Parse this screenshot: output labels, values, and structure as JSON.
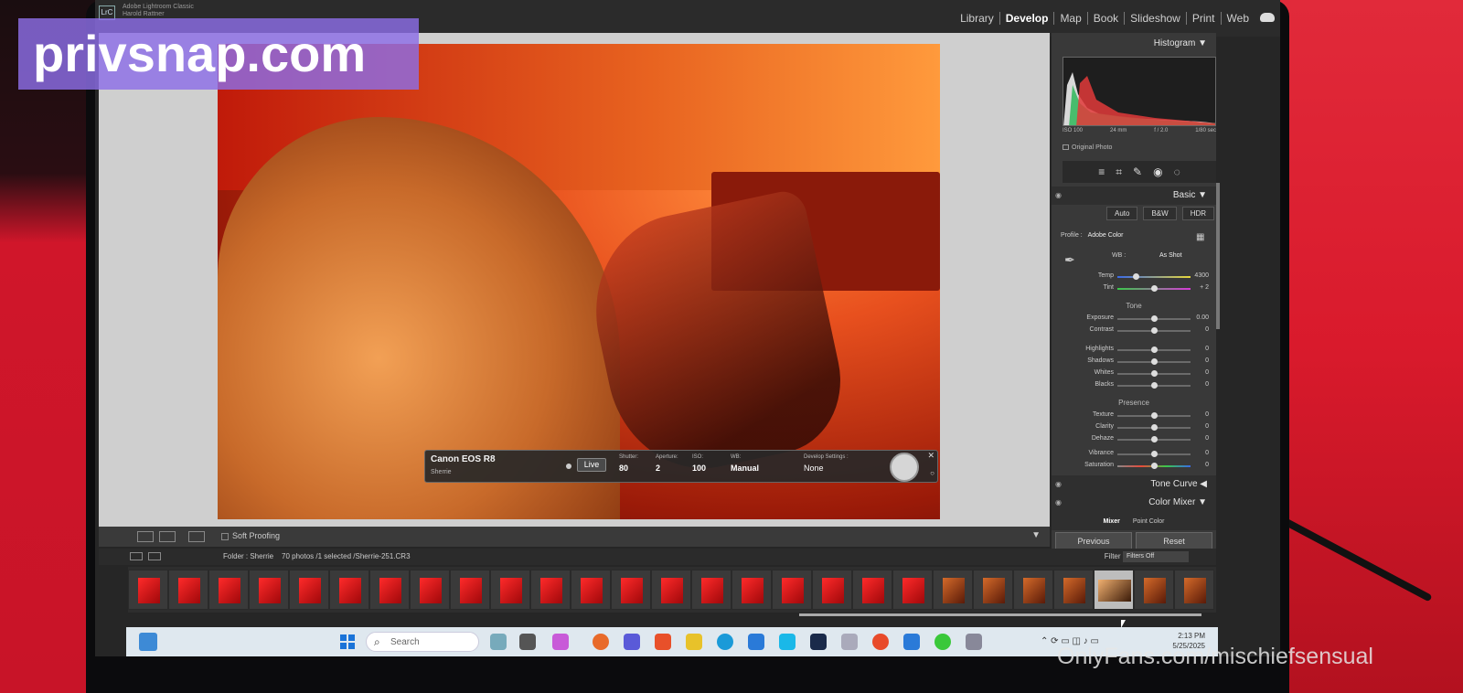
{
  "watermark": {
    "site": "privsnap.com",
    "credit": "OnlyFans.com/mischiefsensual"
  },
  "app": {
    "logo": "LrC",
    "name": "Adobe Lightroom Classic",
    "user": "Harold Rattner"
  },
  "modules": [
    "Library",
    "Develop",
    "Map",
    "Book",
    "Slideshow",
    "Print",
    "Web"
  ],
  "active_module": "Develop",
  "tether": {
    "camera": "Canon EOS R8",
    "session": "Sherrie",
    "live_label": "Live",
    "fields": [
      {
        "label": "Shutter:",
        "value": "80"
      },
      {
        "label": "Aperture:",
        "value": "2"
      },
      {
        "label": "ISO:",
        "value": "100"
      },
      {
        "label": "WB:",
        "value": "Manual"
      },
      {
        "label": "Develop Settings :",
        "value": "None"
      }
    ]
  },
  "toolbar": {
    "soft_proofing": "Soft Proofing"
  },
  "panel": {
    "histogram_title": "Histogram",
    "exif": [
      "ISO 100",
      "24 mm",
      "f / 2.0",
      "1/80 sec"
    ],
    "original_photo": "Original Photo",
    "tool_icons": [
      "sliders-icon",
      "crop-icon",
      "heal-icon",
      "redeye-icon",
      "mask-icon"
    ],
    "basic_title": "Basic",
    "treatment_buttons": [
      "Auto",
      "B&W",
      "HDR"
    ],
    "profile_label": "Profile :",
    "profile_value": "Adobe Color",
    "wb_label": "WB :",
    "wb_value": "As Shot",
    "temp": {
      "name": "Temp",
      "value": "4300",
      "pos": 0.25
    },
    "tint": {
      "name": "Tint",
      "value": "+ 2",
      "pos": 0.5
    },
    "tone_label": "Tone",
    "tone": [
      {
        "name": "Exposure",
        "value": "0.00",
        "pos": 0.5
      },
      {
        "name": "Contrast",
        "value": "0",
        "pos": 0.5
      }
    ],
    "tone2": [
      {
        "name": "Highlights",
        "value": "0",
        "pos": 0.5
      },
      {
        "name": "Shadows",
        "value": "0",
        "pos": 0.5
      },
      {
        "name": "Whites",
        "value": "0",
        "pos": 0.5
      },
      {
        "name": "Blacks",
        "value": "0",
        "pos": 0.5
      }
    ],
    "presence_label": "Presence",
    "presence": [
      {
        "name": "Texture",
        "value": "0",
        "pos": 0.5
      },
      {
        "name": "Clarity",
        "value": "0",
        "pos": 0.5
      },
      {
        "name": "Dehaze",
        "value": "0",
        "pos": 0.5
      }
    ],
    "presence2": [
      {
        "name": "Vibrance",
        "value": "0",
        "pos": 0.5
      },
      {
        "name": "Saturation",
        "value": "0",
        "pos": 0.5
      }
    ],
    "tone_curve_title": "Tone Curve",
    "color_mixer_title": "Color Mixer",
    "mixer_tabs": [
      "Mixer",
      "Point Color"
    ],
    "previous_label": "Previous",
    "reset_label": "Reset"
  },
  "filmstrip": {
    "folder": "Folder : Sherrie",
    "count": "70 photos /1 selected /Sherrie-251.CR3",
    "filter_label": "Filter :",
    "filter_value": "Filters Off",
    "thumb_count": 27,
    "selected_index": 24
  },
  "taskbar": {
    "search_placeholder": "Search",
    "time": "2:13 PM",
    "date": "5/25/2025"
  }
}
